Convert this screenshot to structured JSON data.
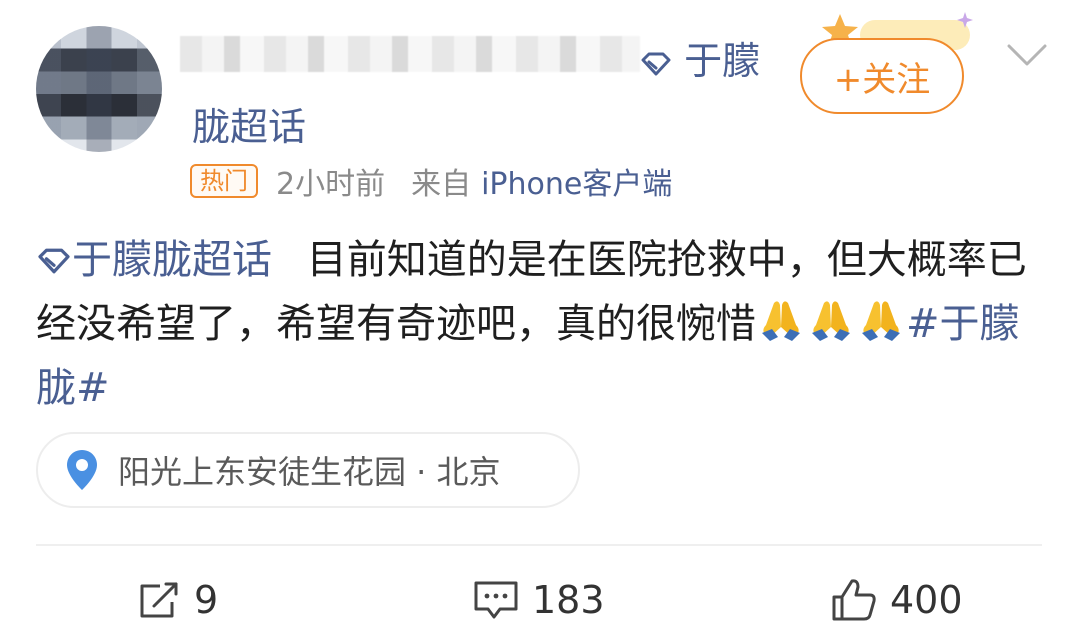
{
  "post": {
    "topic_part1": "于朦",
    "topic_part2": "胧超话",
    "follow_label": "+关注",
    "hot_badge": "热门",
    "time": "2小时前",
    "source_prefix": "来自",
    "source": "iPhone客户端",
    "content_topic": "于朦胧超话",
    "content_text": "目前知道的是在医院抢救中，但大概率已经没希望了，希望有奇迹吧，真的很惋惜",
    "hashtag": "#于朦胧#",
    "location": "阳光上东安徒生花园 · 北京"
  },
  "actions": {
    "share_count": "9",
    "comment_count": "183",
    "like_count": "400"
  },
  "icons": {
    "chevron": "chevron-down-icon",
    "supertopic": "diamond-icon",
    "pin": "location-pin-icon",
    "share": "share-icon",
    "comment": "comment-icon",
    "like": "thumbs-up-icon",
    "emoji": "pray-emoji"
  },
  "colors": {
    "link": "#4a5f92",
    "accent": "#f08a2c",
    "pin": "#4a90e2"
  }
}
